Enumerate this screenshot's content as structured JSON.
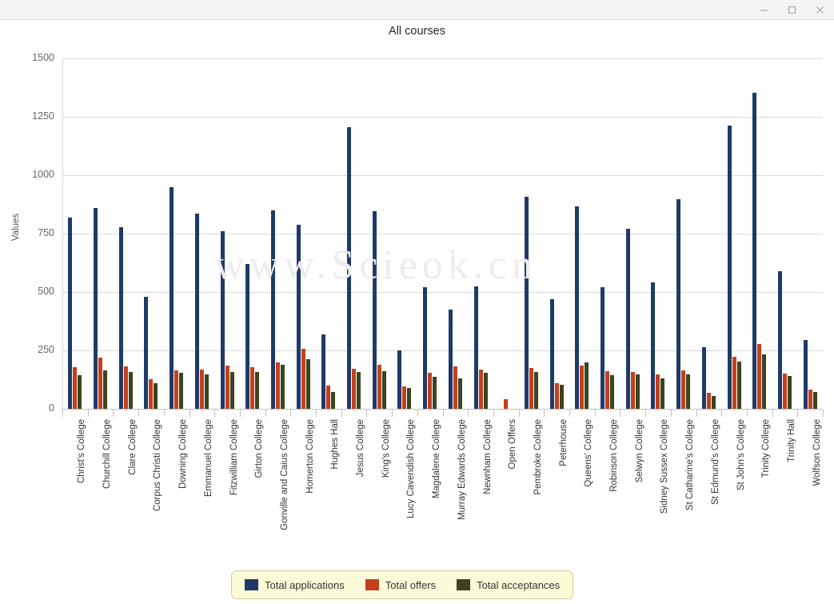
{
  "window": {
    "controls": [
      {
        "name": "minimize",
        "glyph": "minimize-icon"
      },
      {
        "name": "maximize",
        "glyph": "maximize-icon"
      },
      {
        "name": "close",
        "glyph": "close-icon"
      }
    ]
  },
  "watermark": "www.Scieok.cn",
  "colors": {
    "applications": "#1F3A68",
    "offers": "#C4401C",
    "acceptances": "#3A4420",
    "grid": "#d8d8d8",
    "legend_bg": "#fbfbd8",
    "legend_border": "#cfcf9a",
    "background": "#ffffff",
    "titlebar": "#f4f4f4"
  },
  "chart_data": {
    "type": "bar",
    "title": "All courses",
    "xlabel": "",
    "ylabel": "Values",
    "ylim": [
      0,
      1500
    ],
    "yticks": [
      0,
      250,
      500,
      750,
      1000,
      1250,
      1500
    ],
    "grid": true,
    "legend_position": "bottom",
    "categories": [
      "Christ's College",
      "Churchill College",
      "Clare College",
      "Corpus Christi College",
      "Downing College",
      "Emmanuel College",
      "Fitzwilliam College",
      "Girton College",
      "Gonville and Caius College",
      "Homerton College",
      "Hughes Hall",
      "Jesus College",
      "King's College",
      "Lucy Cavendish College",
      "Magdalene College",
      "Murray Edwards College",
      "Newnham College",
      "Open Offers",
      "Pembroke College",
      "Peterhouse",
      "Queens' College",
      "Robinson College",
      "Selwyn College",
      "Sidney Sussex College",
      "St Catharine's College",
      "St Edmund's College",
      "St John's College",
      "Trinity College",
      "Trinity Hall",
      "Wolfson College"
    ],
    "series": [
      {
        "name": "Total applications",
        "color": "#1F3A68",
        "values": [
          818,
          860,
          777,
          481,
          949,
          836,
          759,
          620,
          849,
          787,
          317,
          1205,
          845,
          249,
          519,
          423,
          525,
          0,
          908,
          468,
          865,
          520,
          772,
          541,
          899,
          265,
          1213,
          1352,
          590,
          295
        ]
      },
      {
        "name": "Total offers",
        "color": "#C4401C",
        "values": [
          178,
          219,
          180,
          128,
          163,
          168,
          186,
          179,
          198,
          256,
          98,
          171,
          187,
          96,
          153,
          182,
          168,
          40,
          173,
          110,
          184,
          160,
          157,
          147,
          163,
          70,
          222,
          279,
          152,
          83
        ]
      },
      {
        "name": "Total acceptances",
        "color": "#3A4420",
        "values": [
          145,
          163,
          159,
          108,
          153,
          146,
          156,
          158,
          189,
          212,
          73,
          157,
          160,
          88,
          137,
          130,
          155,
          0,
          156,
          102,
          199,
          145,
          148,
          131,
          146,
          56,
          202,
          233,
          141,
          73
        ]
      }
    ]
  },
  "legend": {
    "items": [
      {
        "label": "Total applications",
        "color": "#1F3A68",
        "swatch_name": "legend-swatch-applications"
      },
      {
        "label": "Total offers",
        "color": "#C4401C",
        "swatch_name": "legend-swatch-offers"
      },
      {
        "label": "Total acceptances",
        "color": "#3A4420",
        "swatch_name": "legend-swatch-acceptances"
      }
    ]
  }
}
